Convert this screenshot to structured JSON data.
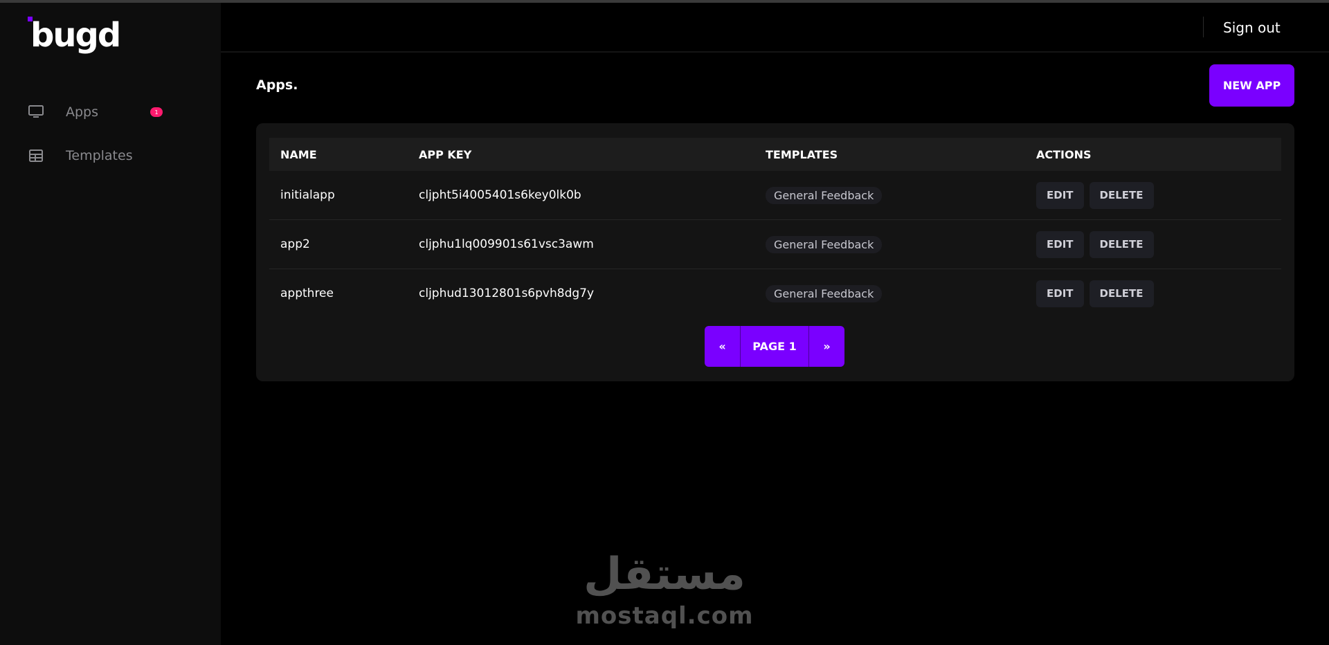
{
  "brand": {
    "logo_text": "bugd",
    "accent": "#7a00ff"
  },
  "sidebar": {
    "items": [
      {
        "label": "Apps",
        "icon": "monitor-icon",
        "badge": "1"
      },
      {
        "label": "Templates",
        "icon": "table-icon"
      }
    ]
  },
  "header": {
    "signout_label": "Sign out"
  },
  "main": {
    "title": "Apps.",
    "new_app_label": "NEW APP",
    "table": {
      "columns": [
        "NAME",
        "APP KEY",
        "TEMPLATES",
        "ACTIONS"
      ],
      "rows": [
        {
          "name": "initialapp",
          "app_key": "cljpht5i4005401s6key0lk0b",
          "template": "General Feedback"
        },
        {
          "name": "app2",
          "app_key": "cljphu1lq009901s61vsc3awm",
          "template": "General Feedback"
        },
        {
          "name": "appthree",
          "app_key": "cljphud13012801s6pvh8dg7y",
          "template": "General Feedback"
        }
      ],
      "edit_label": "EDIT",
      "delete_label": "DELETE"
    },
    "pagination": {
      "prev": "«",
      "page_label": "PAGE 1",
      "next": "»"
    }
  },
  "watermark": {
    "arabic": "مستقل",
    "latin": "mostaql.com"
  }
}
